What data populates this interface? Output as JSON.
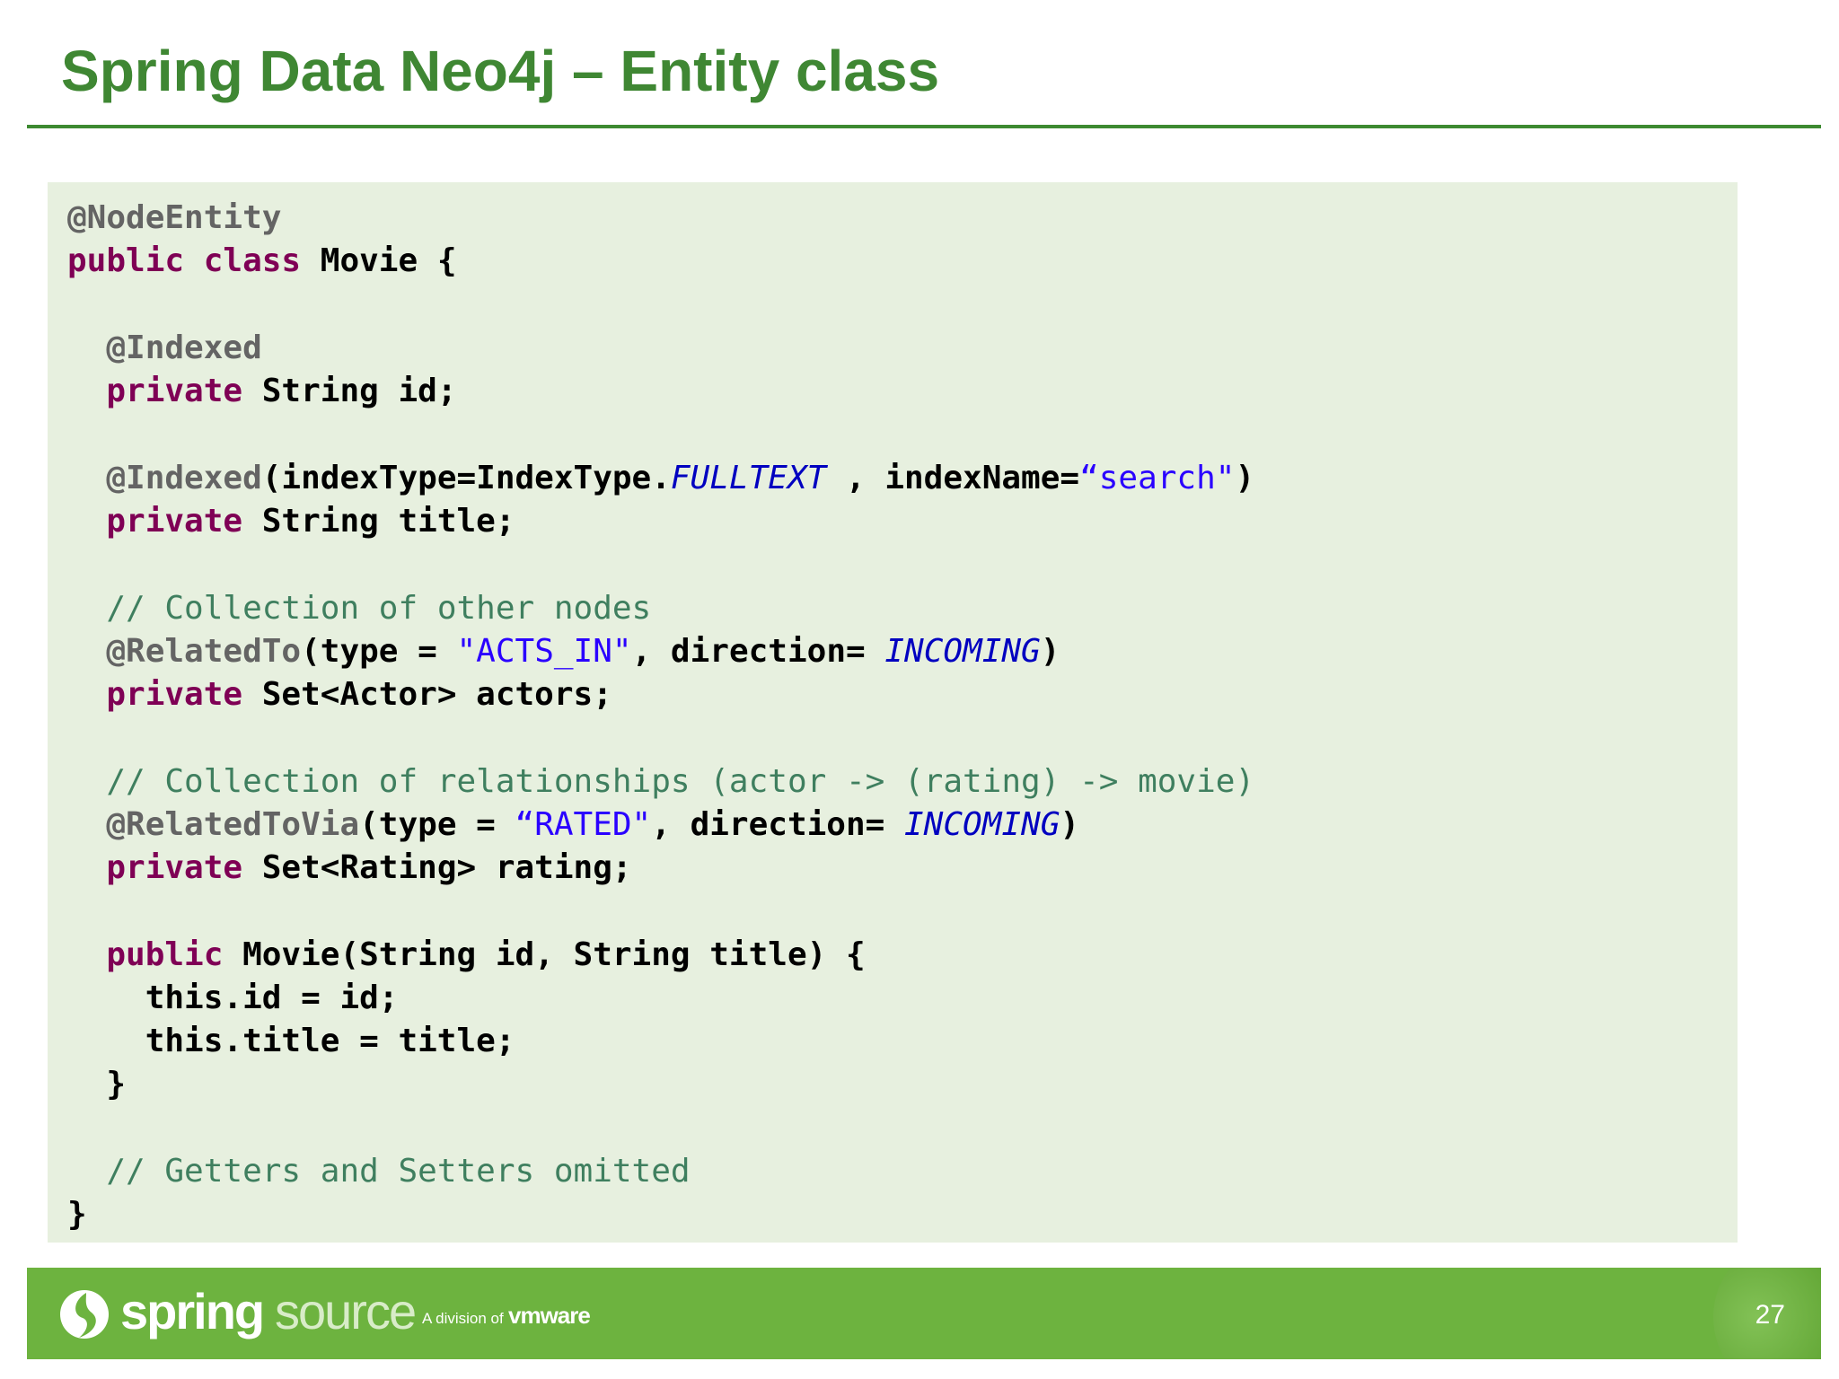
{
  "slide": {
    "title": "Spring Data Neo4j – Entity class",
    "page_number": "27"
  },
  "code": {
    "l1_ann": "@NodeEntity",
    "l2_kw1": "public",
    "l2_kw2": "class",
    "l2_rest": " Movie {",
    "l4_ann": "@Indexed",
    "l5_kw": "private",
    "l5_rest": " String id;",
    "l7_ann": "@Indexed",
    "l7_mid": "(indexType=IndexType.",
    "l7_const": "FULLTEXT",
    "l7_mid2": " , indexName=",
    "l7_str": "“search\"",
    "l7_end": ")",
    "l8_kw": "private",
    "l8_rest": " String title;",
    "l10_com": "// Collection of other nodes",
    "l11_ann": "@RelatedTo",
    "l11_mid": "(type = ",
    "l11_str": "\"ACTS_IN\"",
    "l11_mid2": ", direction= ",
    "l11_const": "INCOMING",
    "l11_end": ")",
    "l12_kw": "private",
    "l12_rest": " Set<Actor> actors;",
    "l14_com": "// Collection of relationships (actor -> (rating) -> movie)",
    "l15_ann": "@RelatedToVia",
    "l15_mid": "(type = ",
    "l15_str": "“RATED\"",
    "l15_mid2": ", direction= ",
    "l15_const": "INCOMING",
    "l15_end": ")",
    "l16_kw": "private",
    "l16_rest": " Set<Rating> rating;",
    "l18_kw": "public",
    "l18_rest": " Movie(String id, String title) {",
    "l19": "this.id = id;",
    "l20": "this.title = title;",
    "l21": "}",
    "l23_com": "// Getters and Setters omitted",
    "l24": "}"
  },
  "footer": {
    "logo_spring": "spring",
    "logo_source": "source",
    "logo_division": "A division of",
    "logo_vmware": "vmware",
    "bar_color": "#6db33f",
    "title_color": "#3f8733"
  },
  "icons": {
    "footer_logo": "springsource-leaf-icon"
  }
}
